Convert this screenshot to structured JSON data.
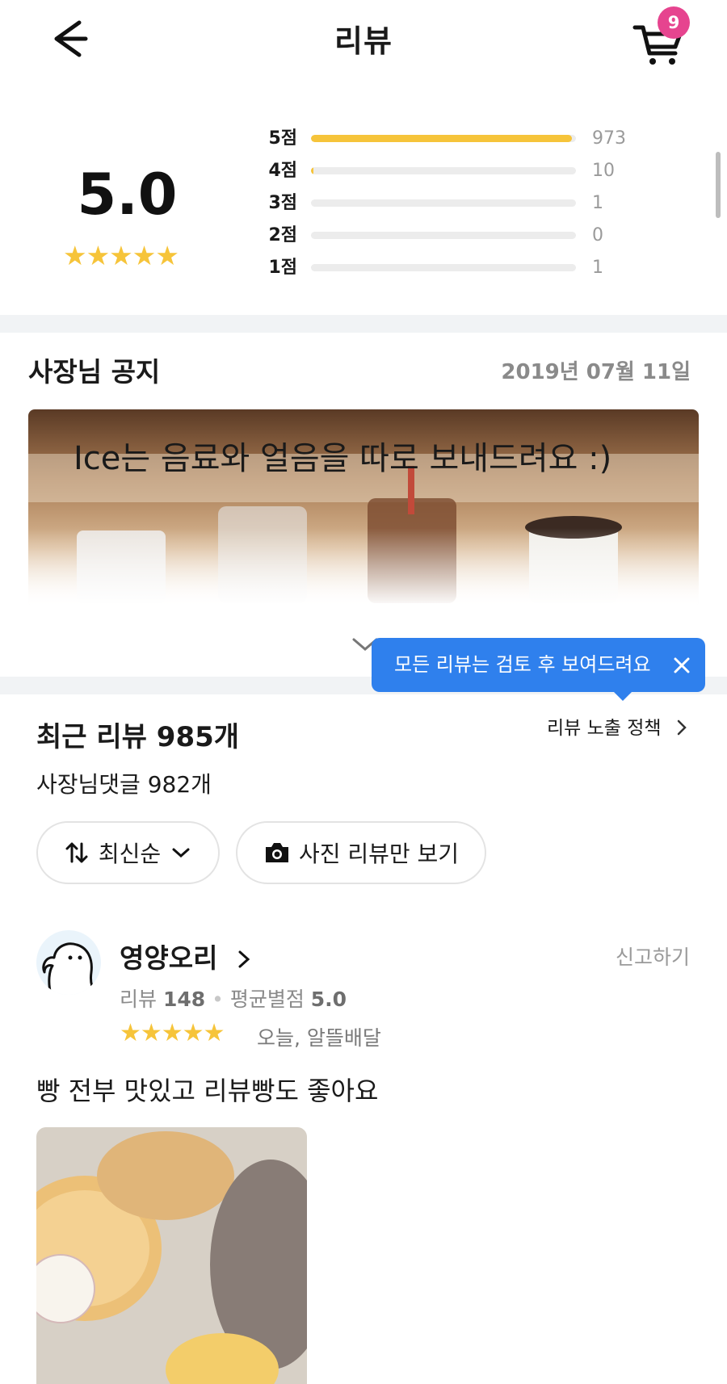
{
  "header": {
    "title": "리뷰",
    "cart_badge": "9",
    "back_icon": "arrow-left-icon",
    "cart_icon": "cart-icon"
  },
  "summary": {
    "average": "5.0",
    "stars": "★★★★★",
    "distribution": [
      {
        "label": "5점",
        "count": "973",
        "fraction": 0.985
      },
      {
        "label": "4점",
        "count": "10",
        "fraction": 0.01
      },
      {
        "label": "3점",
        "count": "1",
        "fraction": 0.0
      },
      {
        "label": "2점",
        "count": "0",
        "fraction": 0.0
      },
      {
        "label": "1점",
        "count": "1",
        "fraction": 0.0
      }
    ]
  },
  "notice": {
    "title": "사장님 공지",
    "date": "2019년 07월 11일",
    "banner_text": "Ice는 음료와 얼음을 따로 보내드려요 :)"
  },
  "tooltip": {
    "text": "모든 리뷰는 검토 후 보여드려요",
    "accent": "#2f80ed"
  },
  "reviews_header": {
    "title": "최근 리뷰 985개",
    "policy_link": "리뷰 노출 정책",
    "reply_count": "사장님댓글 982개",
    "sort_label": "최신순",
    "photo_filter_label": "사진 리뷰만 보기"
  },
  "review": {
    "name": "영양오리",
    "report_label": "신고하기",
    "meta_review_label": "리뷰",
    "meta_review_count": "148",
    "meta_avg_label": "평균별점",
    "meta_avg_value": "5.0",
    "stars": "★★★★★",
    "when": "오늘, 알뜰배달",
    "text": "빵 전부 맛있고 리뷰빵도 좋아요"
  },
  "colors": {
    "star": "#f6c43a",
    "badge": "#e6448f",
    "divider": "#f1f3f5"
  }
}
